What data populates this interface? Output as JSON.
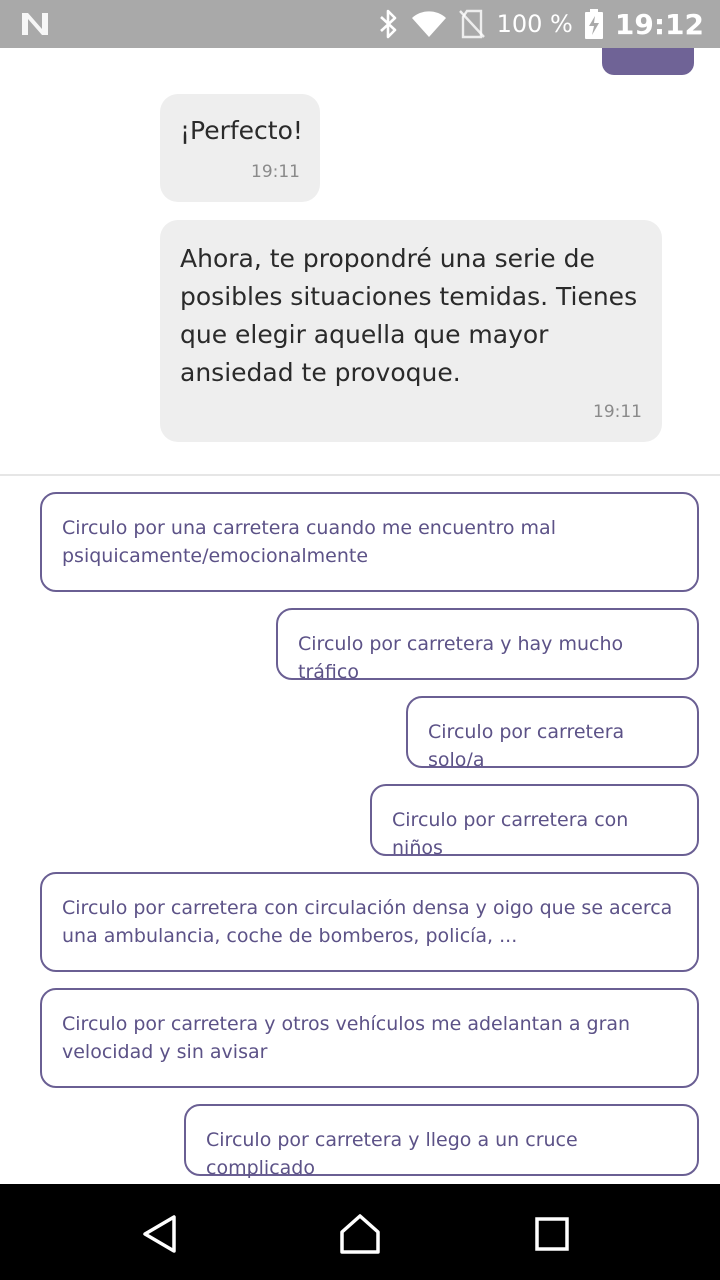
{
  "status_bar": {
    "battery_percent": "100 %",
    "time": "19:12",
    "icons": [
      "notification-n-icon",
      "bluetooth-icon",
      "wifi-icon",
      "no-sim-icon",
      "battery-charging-icon"
    ]
  },
  "chat": {
    "messages": [
      {
        "text": "¡Perfecto!",
        "time": "19:11"
      },
      {
        "text": "Ahora, te propondré una serie de posibles situaciones temidas.  Tienes que elegir aquella que mayor ansiedad te provoque.",
        "time": "19:11"
      }
    ]
  },
  "options": [
    "Circulo por una carretera cuando me encuentro mal psiquicamente/emocionalmente",
    "Circulo por carretera y hay mucho tráfico",
    "Circulo por carretera solo/a",
    "Circulo por carretera con niños",
    "Circulo por carretera con circulación densa y oigo que se acerca una ambulancia, coche de bomberos, policía, ...",
    "Circulo por carretera y otros vehículos me adelantan a gran velocidad y sin avisar",
    "Circulo por carretera y llego a un cruce complicado"
  ],
  "nav": [
    "back-icon",
    "home-icon",
    "recents-icon"
  ],
  "colors": {
    "accent": "#6a5f93",
    "bubble_bg": "#eeeeee",
    "status_bar_bg": "#a9a9a9"
  }
}
